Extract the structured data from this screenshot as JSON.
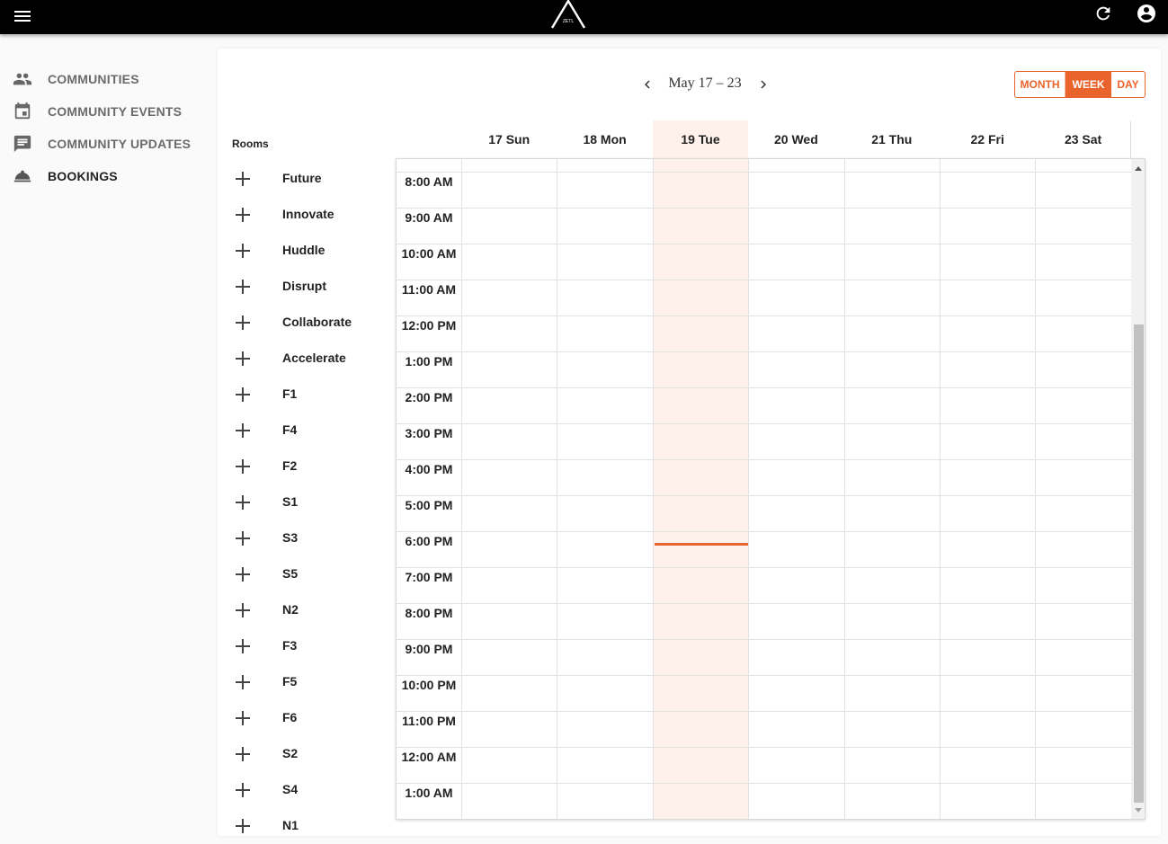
{
  "topbar": {
    "menu_icon": "menu-icon",
    "logo_text": "ZETL",
    "refresh_icon": "refresh-icon",
    "account_icon": "account-circle-icon"
  },
  "sidebar": {
    "items": [
      {
        "label": "COMMUNITIES",
        "icon": "people-icon",
        "active": false
      },
      {
        "label": "COMMUNITY EVENTS",
        "icon": "calendar-icon",
        "active": false
      },
      {
        "label": "COMMUNITY UPDATES",
        "icon": "chat-icon",
        "active": false
      },
      {
        "label": "BOOKINGS",
        "icon": "room-service-icon",
        "active": true
      }
    ]
  },
  "calendar": {
    "range_label": "May 17 – 23",
    "prev_icon": "chevron-left-icon",
    "next_icon": "chevron-right-icon",
    "views": {
      "month": "MONTH",
      "week": "WEEK",
      "day": "DAY",
      "selected": "WEEK"
    },
    "days": [
      "17 Sun",
      "18 Mon",
      "19 Tue",
      "20 Wed",
      "21 Thu",
      "22 Fri",
      "23 Sat"
    ],
    "today": "19 Tue",
    "times": [
      "8:00 AM",
      "9:00 AM",
      "10:00 AM",
      "11:00 AM",
      "12:00 PM",
      "1:00 PM",
      "2:00 PM",
      "3:00 PM",
      "4:00 PM",
      "5:00 PM",
      "6:00 PM",
      "7:00 PM",
      "8:00 PM",
      "9:00 PM",
      "10:00 PM",
      "11:00 PM",
      "12:00 AM",
      "1:00 AM"
    ],
    "accent_color": "#e8642c",
    "today_bg": "#fef0eb"
  },
  "rooms": {
    "title": "Rooms",
    "add_icon": "plus-icon",
    "items": [
      "Future",
      "Innovate",
      "Huddle",
      "Disrupt",
      "Collaborate",
      "Accelerate",
      "F1",
      "F4",
      "F2",
      "S1",
      "S3",
      "S5",
      "N2",
      "F3",
      "F5",
      "F6",
      "S2",
      "S4",
      "N1"
    ]
  }
}
